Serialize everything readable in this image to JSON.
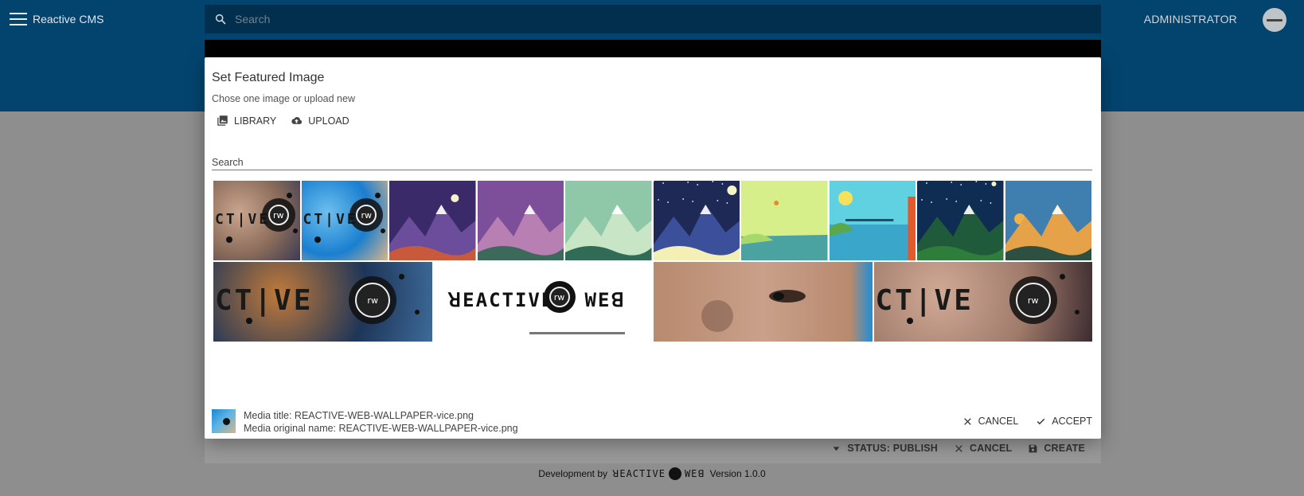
{
  "app": {
    "title": "Reactive CMS",
    "search_placeholder": "Search",
    "user_label": "ADMINISTRATOR"
  },
  "editor_footer": {
    "status_label": "STATUS: PUBLISH",
    "cancel_label": "CANCEL",
    "create_label": "CREATE"
  },
  "credits": {
    "prefix": "Development by",
    "brand_left": "ꓤEACTIVE",
    "brand_right": "WEꓭ",
    "version": "Version 1.0.0"
  },
  "modal": {
    "title": "Set Featured Image",
    "subtitle": "Chose one image or upload new",
    "tabs": [
      {
        "label": "LIBRARY",
        "icon": "image-library-icon"
      },
      {
        "label": "UPLOAD",
        "icon": "cloud-upload-icon"
      }
    ],
    "search_label": "Search",
    "media_title": "Media title: REACTIVE-WEB-WALLPAPER-vice.png",
    "media_original_name": "Media original name: REACTIVE-WEB-WALLPAPER-vice.png",
    "cancel_label": "CANCEL",
    "accept_label": "ACCEPT"
  },
  "library": {
    "row1": [
      {
        "kind": "reactive-wallpaper",
        "palette": [
          "#8a6b5a",
          "#c9a58d",
          "#3b3b55"
        ]
      },
      {
        "kind": "reactive-wallpaper",
        "palette": [
          "#1a7fd0",
          "#6dc0ee",
          "#d8b489"
        ]
      },
      {
        "kind": "mountain-night",
        "palette": [
          "#3a2a6a",
          "#6b4d9c",
          "#c85a3b"
        ]
      },
      {
        "kind": "mountain-purple",
        "palette": [
          "#7d4f9a",
          "#b87fb3",
          "#3b6a5a"
        ]
      },
      {
        "kind": "mountain-mint",
        "palette": [
          "#8fc8a9",
          "#c8e6c6",
          "#2f6b55"
        ]
      },
      {
        "kind": "mountain-stars",
        "palette": [
          "#1e2a55",
          "#3c4f9a",
          "#f4f0b5"
        ]
      },
      {
        "kind": "lake-yellow",
        "palette": [
          "#d6ef8a",
          "#a8d86b",
          "#4aa3a0"
        ]
      },
      {
        "kind": "city-bridge",
        "palette": [
          "#5fd1e0",
          "#f6e25a",
          "#e35a2a"
        ]
      },
      {
        "kind": "forest-night",
        "palette": [
          "#0f2c52",
          "#1f5a3a",
          "#2f7d3a"
        ]
      },
      {
        "kind": "mountain-sunset",
        "palette": [
          "#3f7fb0",
          "#e6a248",
          "#2e5040"
        ]
      }
    ],
    "row2": [
      {
        "kind": "reactive-wallpaper",
        "palette": [
          "#1e3558",
          "#c07a3a",
          "#3d6b9a"
        ]
      },
      {
        "kind": "reactive-logo",
        "palette": [
          "#ffffff",
          "#111111",
          "#777777"
        ]
      },
      {
        "kind": "face-photo",
        "palette": [
          "#b88a6e",
          "#7a5a48",
          "#1e8fd8"
        ]
      },
      {
        "kind": "reactive-wallpaper",
        "palette": [
          "#a07a6a",
          "#d0aa95",
          "#3b2b30"
        ]
      }
    ]
  }
}
